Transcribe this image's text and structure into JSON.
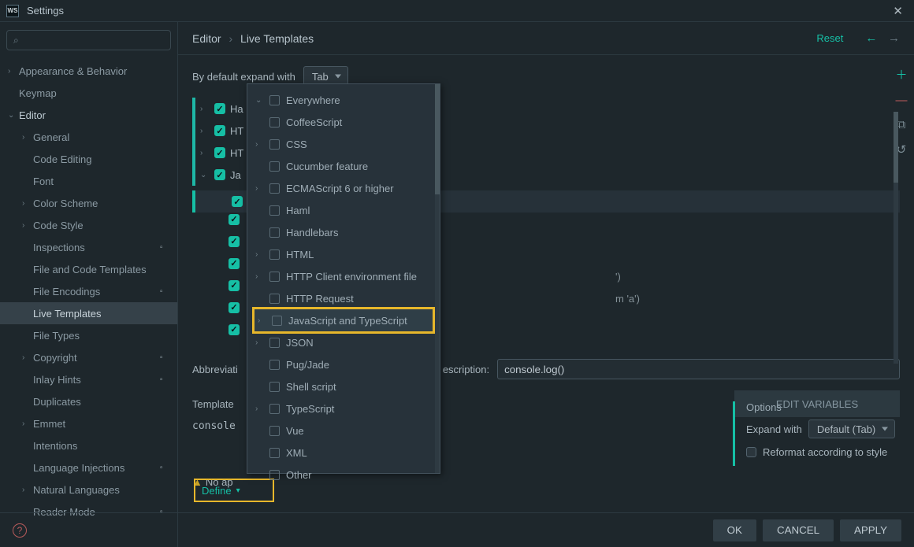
{
  "titlebar": {
    "logo": "WS",
    "title": "Settings"
  },
  "search": {
    "placeholder": ""
  },
  "sidebar": {
    "items": [
      {
        "label": "Appearance & Behavior",
        "arrow": ">",
        "level": 0
      },
      {
        "label": "Keymap",
        "arrow": "",
        "level": 0
      },
      {
        "label": "Editor",
        "arrow": "v",
        "level": -1,
        "accent": true
      },
      {
        "label": "General",
        "arrow": ">",
        "level": 1
      },
      {
        "label": "Code Editing",
        "arrow": "",
        "level": 1
      },
      {
        "label": "Font",
        "arrow": "",
        "level": 1
      },
      {
        "label": "Color Scheme",
        "arrow": ">",
        "level": 1
      },
      {
        "label": "Code Style",
        "arrow": ">",
        "level": 1
      },
      {
        "label": "Inspections",
        "arrow": "",
        "level": 1,
        "mod": true
      },
      {
        "label": "File and Code Templates",
        "arrow": "",
        "level": 1
      },
      {
        "label": "File Encodings",
        "arrow": "",
        "level": 1,
        "mod": true
      },
      {
        "label": "Live Templates",
        "arrow": "",
        "level": 1,
        "sel": true
      },
      {
        "label": "File Types",
        "arrow": "",
        "level": 1
      },
      {
        "label": "Copyright",
        "arrow": ">",
        "level": 1,
        "mod": true
      },
      {
        "label": "Inlay Hints",
        "arrow": "",
        "level": 1,
        "mod": true
      },
      {
        "label": "Duplicates",
        "arrow": "",
        "level": 1
      },
      {
        "label": "Emmet",
        "arrow": ">",
        "level": 1
      },
      {
        "label": "Intentions",
        "arrow": "",
        "level": 1
      },
      {
        "label": "Language Injections",
        "arrow": "",
        "level": 1,
        "mod": true
      },
      {
        "label": "Natural Languages",
        "arrow": ">",
        "level": 1
      },
      {
        "label": "Reader Mode",
        "arrow": "",
        "level": 1,
        "mod": true
      }
    ]
  },
  "breadcrumb": {
    "a": "Editor",
    "b": "Live Templates"
  },
  "reset": "Reset",
  "toprow": {
    "label": "By default expand with",
    "select": "Tab"
  },
  "templateTree": {
    "rows": [
      {
        "tri": ">",
        "label": "Ha"
      },
      {
        "tri": ">",
        "label": "HT"
      },
      {
        "tri": ">",
        "label": "HT"
      },
      {
        "tri": "v",
        "label": "Ja"
      }
    ]
  },
  "popup": {
    "items": [
      {
        "label": "Everywhere",
        "tri": "v"
      },
      {
        "label": "CoffeeScript",
        "tri": ""
      },
      {
        "label": "CSS",
        "tri": ">"
      },
      {
        "label": "Cucumber feature",
        "tri": ""
      },
      {
        "label": "ECMAScript 6 or higher",
        "tri": ">"
      },
      {
        "label": "Haml",
        "tri": ""
      },
      {
        "label": "Handlebars",
        "tri": ""
      },
      {
        "label": "HTML",
        "tri": ">"
      },
      {
        "label": "HTTP Client environment file",
        "tri": ">"
      },
      {
        "label": "HTTP Request",
        "tri": ""
      },
      {
        "label": "JavaScript and TypeScript",
        "tri": ">",
        "hover": true
      },
      {
        "label": "JSON",
        "tri": ">"
      },
      {
        "label": "Pug/Jade",
        "tri": ""
      },
      {
        "label": "Shell script",
        "tri": ""
      },
      {
        "label": "TypeScript",
        "tri": ">"
      },
      {
        "label": "Vue",
        "tri": ""
      },
      {
        "label": "XML",
        "tri": ""
      },
      {
        "label": "Other",
        "tri": ""
      }
    ]
  },
  "peek": {
    "t1": "')",
    "t2": "m 'a')"
  },
  "form": {
    "abbrLabel": "Abbreviati",
    "descLabel": "escription:",
    "descValue": "console.log()",
    "templateLabel": "Template",
    "templateCode": "console",
    "editVars": "EDIT VARIABLES",
    "warning": "No ap",
    "defineLabel": "Define"
  },
  "options": {
    "title": "Options",
    "expandLabel": "Expand with",
    "expandSelect": "Default (Tab)",
    "reformat": "Reformat according to style"
  },
  "footer": {
    "ok": "OK",
    "cancel": "CANCEL",
    "apply": "APPLY"
  }
}
